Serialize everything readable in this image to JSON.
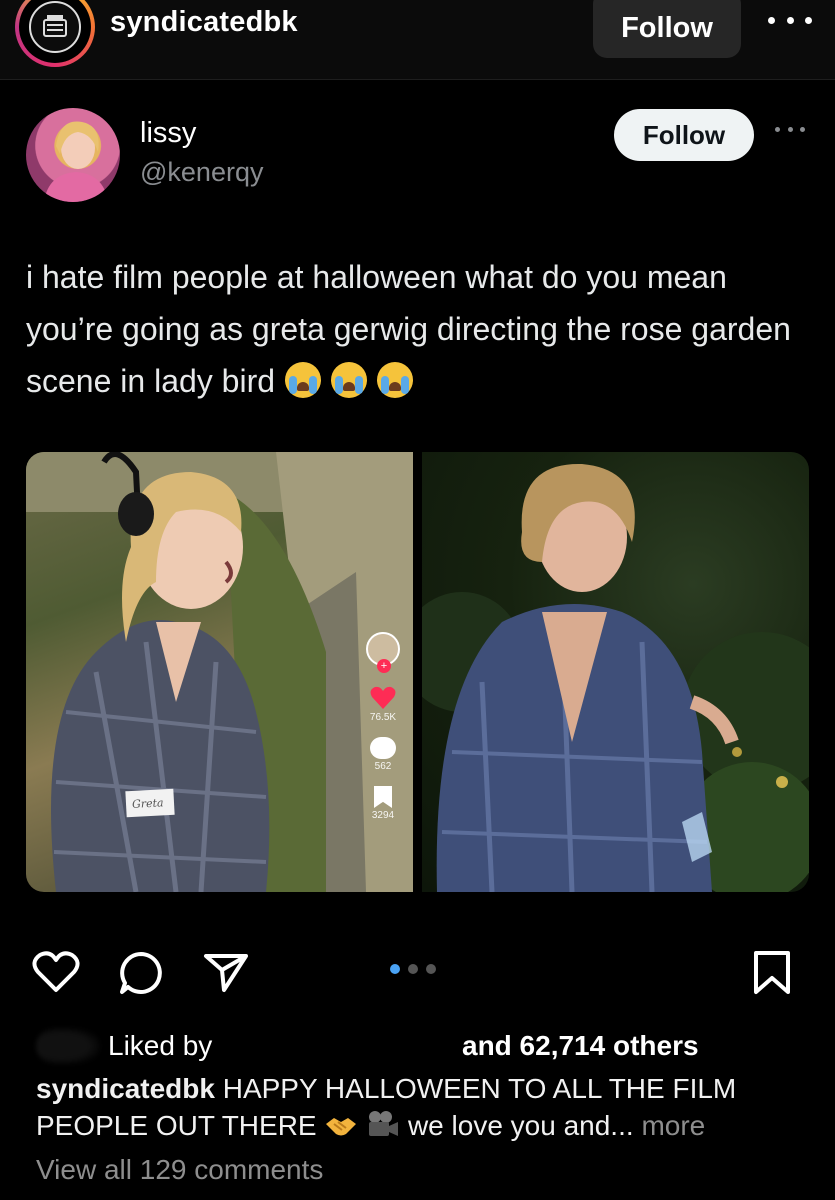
{
  "post_header": {
    "username": "syndicatedbk",
    "follow_label": "Follow"
  },
  "tweet": {
    "display_name": "lissy",
    "handle": "@kenerqy",
    "follow_label": "Follow",
    "text": "i hate film people at halloween what do you mean you’re going as greta gerwig directing the rose garden scene in lady bird",
    "emojis": [
      "loudly-crying-face",
      "loudly-crying-face",
      "loudly-crying-face"
    ],
    "tiktok_rail": {
      "likes": "76.5K",
      "comments": "562",
      "saves": "3294"
    },
    "name_tag": "Greta"
  },
  "actions": {
    "icons": [
      "heart-icon",
      "comment-icon",
      "share-icon",
      "bookmark-icon"
    ],
    "carousel": {
      "count": 3,
      "active": 1
    },
    "accent_color": "#4aa3f5"
  },
  "likes": {
    "liked_by": "Liked by",
    "and_others": "and 62,714 others"
  },
  "caption": {
    "username": "syndicatedbk",
    "text_before": "HAPPY HALLOWEEN TO ALL THE FILM PEOPLE OUT THERE",
    "text_after": "we love you and...",
    "more": "more",
    "emojis": [
      "handshake",
      "movie-camera"
    ]
  },
  "view_comments": "View all 129 comments"
}
